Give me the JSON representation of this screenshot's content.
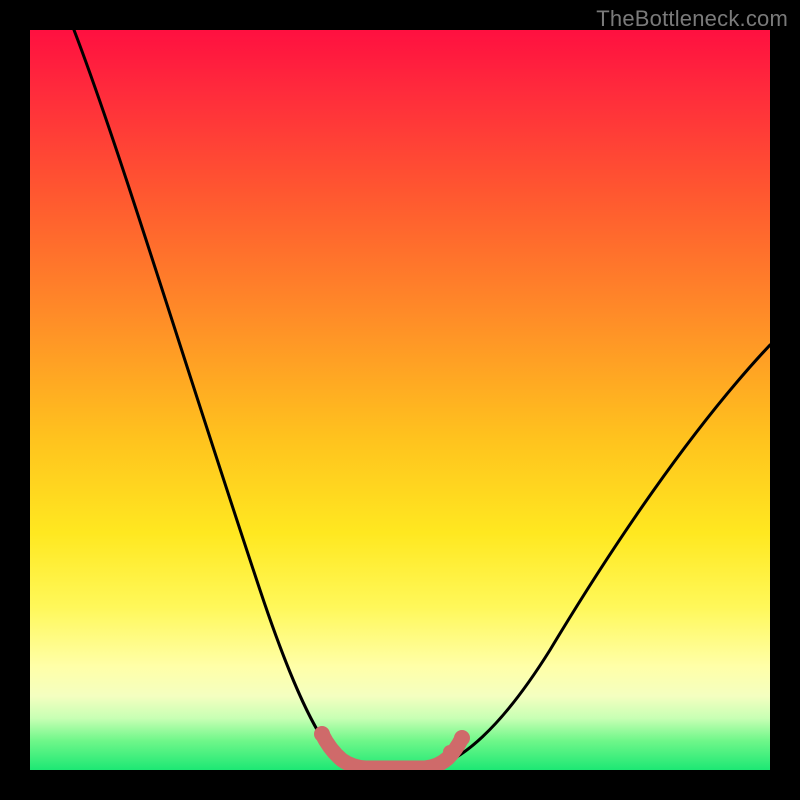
{
  "watermark": "TheBottleneck.com",
  "colors": {
    "frame": "#000000",
    "curve": "#000000",
    "highlight": "#cf6a6a",
    "gradient_stops": [
      "#ff1040",
      "#ff2a3c",
      "#ff5730",
      "#ff8a28",
      "#ffc21e",
      "#ffe820",
      "#fff85a",
      "#ffffa8",
      "#f4ffc0",
      "#c8ffb4",
      "#70f78a",
      "#1de874"
    ]
  },
  "chart_data": {
    "type": "line",
    "title": "",
    "xlabel": "",
    "ylabel": "",
    "xlim": [
      0,
      100
    ],
    "ylim": [
      0,
      100
    ],
    "grid": false,
    "legend": false,
    "series": [
      {
        "name": "bottleneck-curve",
        "x": [
          6,
          10,
          15,
          20,
          25,
          30,
          34,
          37,
          40,
          42,
          44,
          46,
          50,
          54,
          58,
          62,
          68,
          76,
          84,
          92,
          100
        ],
        "y": [
          100,
          88,
          74,
          60,
          46,
          32,
          20,
          12,
          6,
          2,
          0,
          0,
          0,
          2,
          8,
          16,
          26,
          38,
          48,
          56,
          62
        ]
      }
    ],
    "highlight": {
      "name": "optimal-range",
      "x": [
        40,
        42,
        44,
        46,
        50,
        54,
        56
      ],
      "y": [
        6,
        2,
        0,
        0,
        0,
        2,
        5
      ]
    },
    "annotations": [
      {
        "text": "TheBottleneck.com",
        "position": "top-right"
      }
    ]
  }
}
